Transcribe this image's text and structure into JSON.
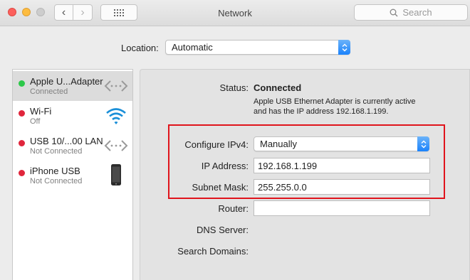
{
  "window": {
    "title": "Network",
    "search_placeholder": "Search",
    "back_glyph": "‹",
    "forward_glyph": "›",
    "grid_glyph": "⋮⋮⋮"
  },
  "location": {
    "label": "Location:",
    "value": "Automatic"
  },
  "services": [
    {
      "name": "Apple U...Adapter",
      "status": "Connected",
      "dot_color": "#2dc84a",
      "icon": "ethernet-icon",
      "selected": true
    },
    {
      "name": "Wi-Fi",
      "status": "Off",
      "dot_color": "#e0263c",
      "icon": "wifi-icon",
      "selected": false
    },
    {
      "name": "USB 10/...00 LAN",
      "status": "Not Connected",
      "dot_color": "#e0263c",
      "icon": "ethernet-icon",
      "selected": false
    },
    {
      "name": "iPhone USB",
      "status": "Not Connected",
      "dot_color": "#e0263c",
      "icon": "iphone-icon",
      "selected": false
    }
  ],
  "details": {
    "status_label": "Status:",
    "status_value": "Connected",
    "status_desc_line1": "Apple USB Ethernet Adapter is currently active",
    "status_desc_line2": "and has the IP address 192.168.1.199.",
    "configure_label": "Configure IPv4:",
    "configure_value": "Manually",
    "ip_label": "IP Address:",
    "ip_value": "192.168.1.199",
    "subnet_label": "Subnet Mask:",
    "subnet_value": "255.255.0.0",
    "router_label": "Router:",
    "router_value": "",
    "dns_label": "DNS Server:",
    "search_domains_label": "Search Domains:"
  },
  "colors": {
    "accent": "#1a82fb",
    "highlight": "#e0141c"
  }
}
